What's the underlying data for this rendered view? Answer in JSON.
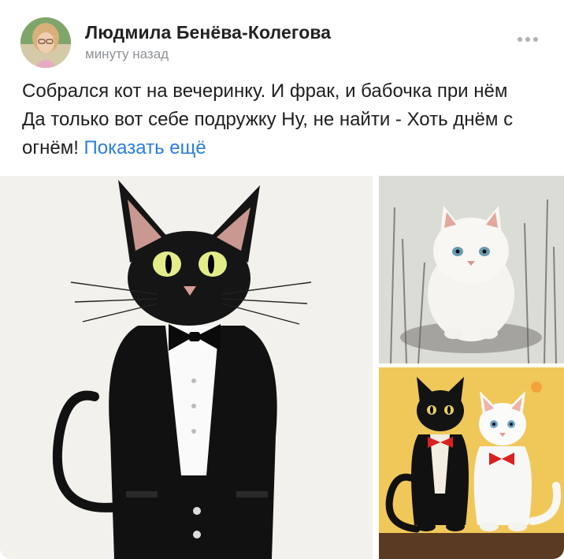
{
  "post": {
    "author_name": "Людмила Бенёва-Колегова",
    "timestamp": "минуту назад",
    "text": "Собрался кот на вечеринку. И фрак, и бабочка при нём Да только вот себе подружку Ну, не найти - Хоть днём с огнём!",
    "show_more_label": "Показать ещё"
  },
  "icons": {
    "avatar": "avatar-photo",
    "more": "more-horizontal-icon"
  },
  "photos": [
    {
      "name": "photo-black-cat-tuxedo",
      "subject": "black-cat-in-tuxedo"
    },
    {
      "name": "photo-white-fluffy-cat",
      "subject": "white-fluffy-cat"
    },
    {
      "name": "photo-two-cats-bowties",
      "subject": "black-and-white-cats-with-bowties"
    }
  ],
  "colors": {
    "link": "#2a7de1",
    "text": "#1f1f1f",
    "secondary": "#8e9398"
  }
}
